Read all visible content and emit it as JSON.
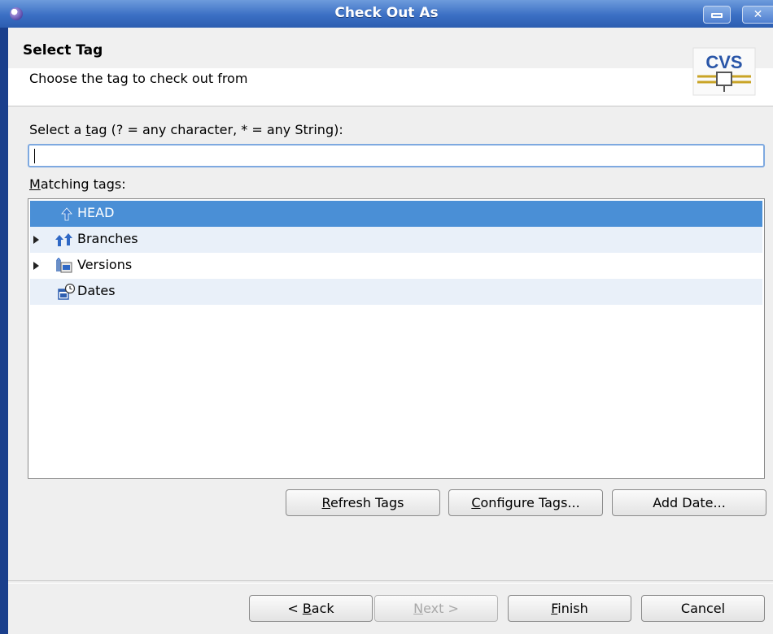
{
  "window": {
    "title": "Check Out As"
  },
  "header": {
    "title": "Select Tag",
    "description": "Choose the tag to check out from",
    "logo_text": "CVS"
  },
  "tag_filter": {
    "label_pre": "Select a ",
    "label_mnemonic": "t",
    "label_post": "ag (? = any character, * = any String):",
    "value": ""
  },
  "matching": {
    "label_mnemonic": "M",
    "label_post": "atching tags:",
    "items": [
      {
        "label": "HEAD",
        "selected": true,
        "expandable": false,
        "icon": "head-tag-icon"
      },
      {
        "label": "Branches",
        "selected": false,
        "expandable": true,
        "icon": "branches-icon"
      },
      {
        "label": "Versions",
        "selected": false,
        "expandable": true,
        "icon": "versions-icon"
      },
      {
        "label": "Dates",
        "selected": false,
        "expandable": false,
        "icon": "dates-icon"
      }
    ]
  },
  "actions": {
    "refresh_mn": "R",
    "refresh_rest": "efresh Tags",
    "configure_mn": "C",
    "configure_rest": "onfigure Tags...",
    "add_date": "Add Date..."
  },
  "footer": {
    "back_pre": "< ",
    "back_mn": "B",
    "back_rest": "ack",
    "next_mn": "N",
    "next_rest": "ext >",
    "finish_mn": "F",
    "finish_rest": "inish",
    "cancel": "Cancel"
  },
  "colors": {
    "selection": "#4a8fd6",
    "titlebar": "#3b6fc4",
    "alt_row": "#e9f0f9"
  }
}
